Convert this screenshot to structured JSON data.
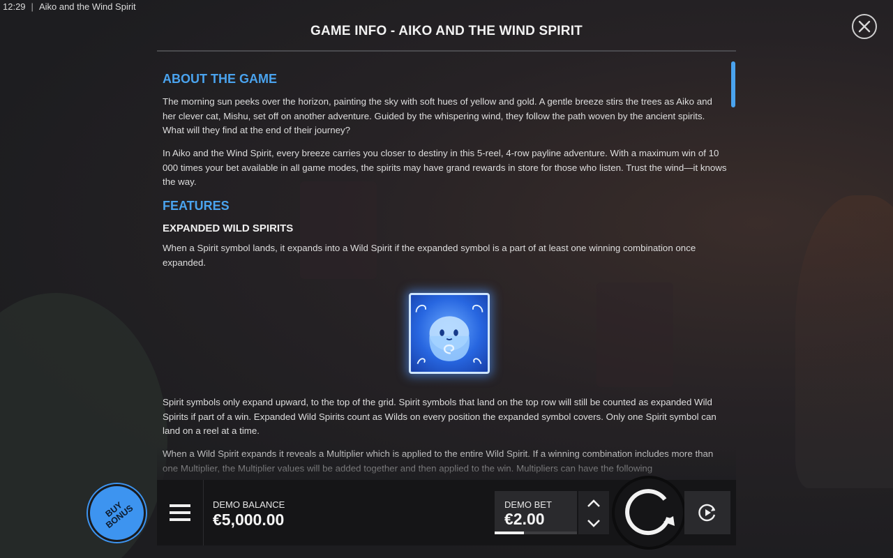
{
  "status_bar": {
    "time": "12:29",
    "separator": "|",
    "app_title": "Aiko and the Wind Spirit"
  },
  "info_panel": {
    "title": "GAME INFO - AIKO AND THE WIND SPIRIT",
    "about_heading": "ABOUT THE GAME",
    "about_paragraphs": [
      "The morning sun peeks over the horizon, painting the sky with soft hues of yellow and gold. A gentle breeze stirs the trees as Aiko and her clever cat, Mishu, set off on another adventure. Guided by the whispering wind, they follow the path woven by the ancient spirits. What will they find at the end of their journey?",
      "In Aiko and the Wind Spirit, every breeze carries you closer to destiny in this 5-reel, 4-row payline adventure. With a maximum win of 10 000 times your bet available in all game modes, the spirits may have grand rewards in store for those who listen. Trust the wind—it knows the way."
    ],
    "features_heading": "FEATURES",
    "feature_title": "EXPANDED WILD SPIRITS",
    "feature_intro": "When a Spirit symbol lands, it expands into a Wild Spirit if the expanded symbol is a part of at least one winning combination once expanded.",
    "feature_paragraphs": [
      "Spirit symbols only expand upward, to the top of the grid. Spirit symbols that land on the top row will still be counted as expanded Wild Spirits if part of a win. Expanded Wild Spirits count as Wilds on every position the expanded symbol covers. Only one Spirit symbol can land on a reel at a time.",
      "When a Wild Spirit expands it reveals a Multiplier which is applied to the entire Wild Spirit. If a winning combination includes more than one Multiplier, the Multiplier values will be added together and then applied to the win. Multipliers can have the following"
    ],
    "symbol_icon": "spirit-symbol-icon"
  },
  "controls": {
    "buy_bonus_line1": "BUY",
    "buy_bonus_line2": "BONUS",
    "balance_label": "DEMO BALANCE",
    "balance_value": "€5,000.00",
    "bet_label": "DEMO BET",
    "bet_value": "€2.00",
    "bet_level_fraction": 0.36,
    "icons": [
      "menu-icon",
      "chevron-up-icon",
      "chevron-down-icon",
      "spin-icon",
      "autoplay-icon",
      "close-icon"
    ]
  },
  "colors": {
    "accent": "#4aa3ee",
    "buy_bonus": "#3d94f0",
    "panel_bg": "#1e1e21"
  }
}
